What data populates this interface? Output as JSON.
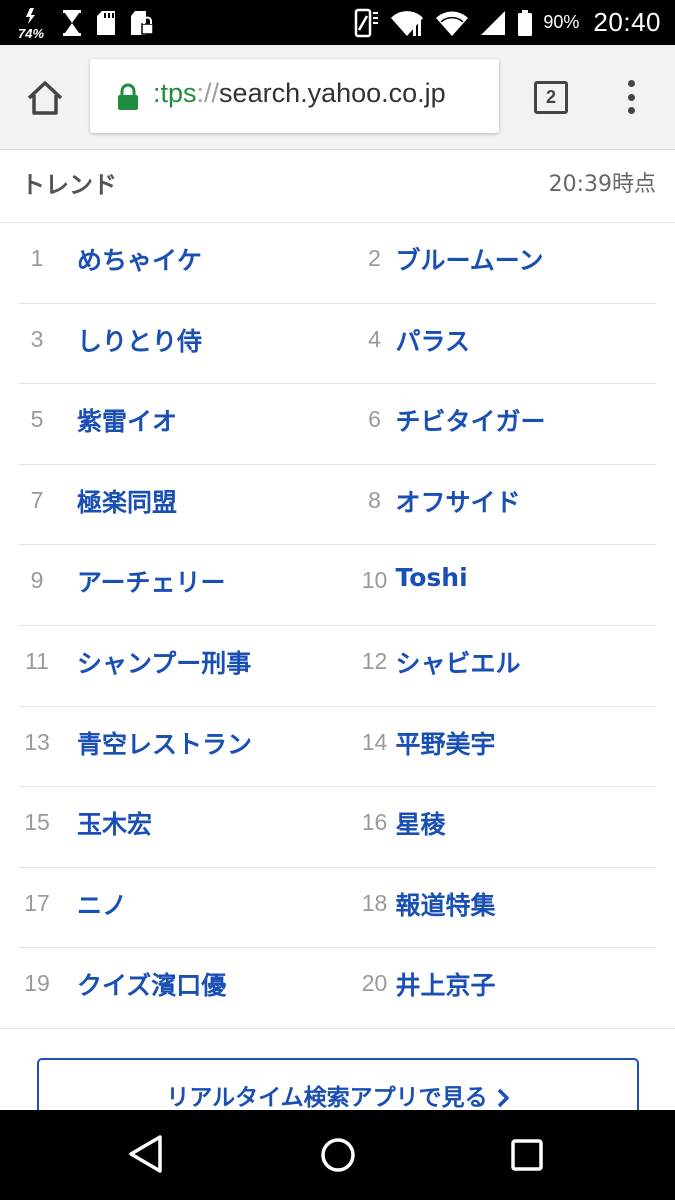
{
  "status_bar": {
    "left_percent": "74%",
    "battery_percent": "90%",
    "time": "20:40"
  },
  "browser": {
    "url_scheme": ":tps",
    "url_separator": "://",
    "url_host": "search.yahoo.co.jp",
    "tab_count": "2"
  },
  "trend": {
    "title": "トレンド",
    "timestamp": "20:39時点",
    "items": [
      {
        "rank": "1",
        "word": "めちゃイケ"
      },
      {
        "rank": "2",
        "word": "ブルームーン"
      },
      {
        "rank": "3",
        "word": "しりとり侍"
      },
      {
        "rank": "4",
        "word": "パラス"
      },
      {
        "rank": "5",
        "word": "紫雷イオ"
      },
      {
        "rank": "6",
        "word": "チビタイガー"
      },
      {
        "rank": "7",
        "word": "極楽同盟"
      },
      {
        "rank": "8",
        "word": "オフサイド"
      },
      {
        "rank": "9",
        "word": "アーチェリー"
      },
      {
        "rank": "10",
        "word": "Toshi"
      },
      {
        "rank": "11",
        "word": "シャンプー刑事"
      },
      {
        "rank": "12",
        "word": "シャビエル"
      },
      {
        "rank": "13",
        "word": "青空レストラン"
      },
      {
        "rank": "14",
        "word": "平野美宇"
      },
      {
        "rank": "15",
        "word": "玉木宏"
      },
      {
        "rank": "16",
        "word": "星稜"
      },
      {
        "rank": "17",
        "word": "ニノ"
      },
      {
        "rank": "18",
        "word": "報道特集"
      },
      {
        "rank": "19",
        "word": "クイズ濱口優"
      },
      {
        "rank": "20",
        "word": "井上京子"
      }
    ]
  },
  "app_button": {
    "label": "リアルタイム検索アプリで見る"
  },
  "colors": {
    "link_blue": "#1a4fb4",
    "rank_gray": "#9a9a9a",
    "lock_green": "#1e8e3e"
  },
  "icons": {
    "home": "home-icon",
    "lock": "lock-icon",
    "tabs": "tab-switcher-icon",
    "menu": "overflow-menu-icon",
    "back": "nav-back-icon",
    "nav_home": "nav-home-icon",
    "recents": "nav-recents-icon"
  }
}
